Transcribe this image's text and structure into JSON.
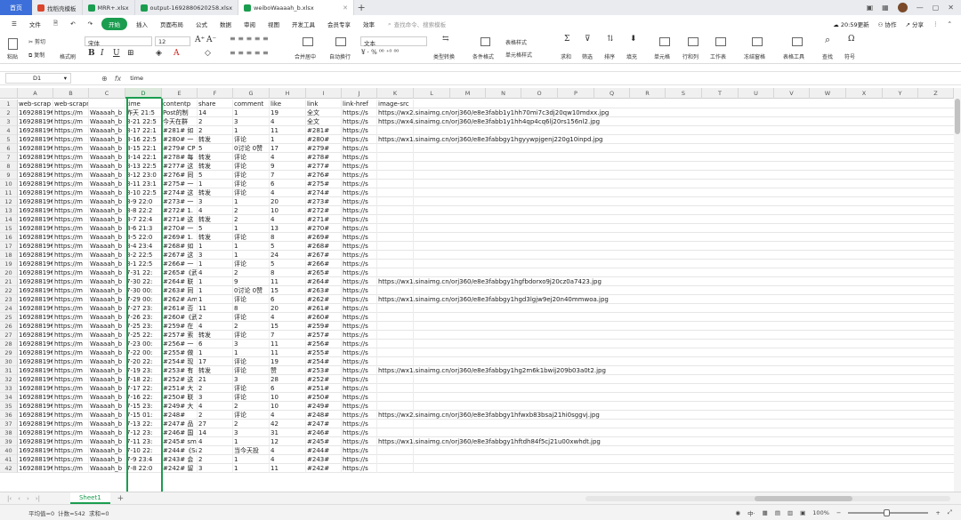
{
  "tabs": {
    "home": "首页",
    "t1": "找稻壳模板",
    "t2": "MRR+.xlsx",
    "t3": "output-1692880620258.xlsx",
    "t4": "weiboWaaaah_b.xlsx"
  },
  "menu": {
    "file": "文件",
    "start": "开始",
    "insert": "插入",
    "layout": "页面布局",
    "formula": "公式",
    "data": "数据",
    "review": "审阅",
    "view": "视图",
    "dev": "开发工具",
    "member": "会员专享",
    "efficiency": "效率",
    "search": "查找命令、搜索模板",
    "update": "20:59更新",
    "collab": "协作",
    "share": "分享"
  },
  "ribbon": {
    "paste": "粘贴",
    "cut": "剪切",
    "copy": "复制",
    "painter": "格式刷",
    "font": "宋体",
    "size": "12",
    "merge": "合并居中",
    "wrap": "自动换行",
    "numfmt": "文本",
    "typeconv": "类型转换",
    "condfmt": "条件格式",
    "tablestyle": "表格样式",
    "cellstyle": "单元格样式",
    "sum": "求和",
    "filter": "筛选",
    "sort": "排序",
    "fill": "填充",
    "cell": "单元格",
    "rowcol": "行和列",
    "sheet": "工作表",
    "freeze": "冻结窗格",
    "tabletool": "表格工具",
    "find": "查找",
    "symbol": "符号"
  },
  "formula_bar": {
    "cell_ref": "D1",
    "value": "time"
  },
  "columns": [
    "A",
    "B",
    "C",
    "D",
    "E",
    "F",
    "G",
    "H",
    "I",
    "J",
    "K",
    "L",
    "M",
    "N",
    "O",
    "P",
    "Q",
    "R",
    "S",
    "T",
    "U",
    "V",
    "W",
    "X",
    "Y",
    "Z"
  ],
  "header_row": [
    "web-scrap",
    "web-scrapname",
    "",
    "time",
    "contentp",
    "share",
    "comment",
    "like",
    "link",
    "link-href",
    "image-src"
  ],
  "rows": [
    [
      "16928819€",
      "https://m",
      "Waaaah_b",
      "昨天 21:5",
      "Post的制",
      "14",
      "1",
      "19",
      "全文",
      "https://s",
      "https://wx2.sinaimg.cn/orj360/e8e3fabb1y1hh70mi7c3dj20qw10mdxx.jpg"
    ],
    [
      "16928819€",
      "https://m",
      "Waaaah_b",
      "8-21 22:5",
      "今天在群",
      "2",
      "3",
      "4",
      "全文",
      "https://s",
      "https://wx4.sinaimg.cn/orj360/e8e3fabb1y1hh4qp4cq6lj20rs156nl2.jpg"
    ],
    [
      "16928819€",
      "https://m",
      "Waaaah_b",
      "8-17 22:1",
      "#281# 如",
      "2",
      "1",
      "11",
      "#281#",
      "https://s",
      ""
    ],
    [
      "16928819€",
      "https://m",
      "Waaaah_b",
      "8-16 22:5",
      "#280# 一",
      "转发",
      "评论",
      "1",
      "#280#",
      "https://s",
      "https://wx1.sinaimg.cn/orj360/e8e3fabbgy1hgyywpjgenj220g10inpd.jpg"
    ],
    [
      "16928819€",
      "https://m",
      "Waaaah_b",
      "8-15 22:1",
      "#279# CP",
      "5",
      "0讨论 0赞",
      "17",
      "#279#",
      "https://s",
      ""
    ],
    [
      "16928819€",
      "https://m",
      "Waaaah_b",
      "8-14 22:1",
      "#278# 每",
      "转发",
      "评论",
      "4",
      "#278#",
      "https://s",
      ""
    ],
    [
      "16928819€",
      "https://m",
      "Waaaah_b",
      "8-13 22:5",
      "#277# 这",
      "转发",
      "评论",
      "9",
      "#277#",
      "https://s",
      ""
    ],
    [
      "16928819€",
      "https://m",
      "Waaaah_b",
      "8-12 23:0",
      "#276# 同",
      "5",
      "评论",
      "7",
      "#276#",
      "https://s",
      ""
    ],
    [
      "16928819€",
      "https://m",
      "Waaaah_b",
      "8-11 23:1",
      "#275# 一",
      "1",
      "评论",
      "6",
      "#275#",
      "https://s",
      ""
    ],
    [
      "16928819€",
      "https://m",
      "Waaaah_b",
      "8-10 22:5",
      "#274# 这",
      "转发",
      "评论",
      "4",
      "#274#",
      "https://s",
      ""
    ],
    [
      "16928819€",
      "https://m",
      "Waaaah_b",
      "8-9 22:0",
      "#273# 一",
      "3",
      "1",
      "20",
      "#273#",
      "https://s",
      ""
    ],
    [
      "16928819€",
      "https://m",
      "Waaaah_b",
      "8-8 22:2",
      "#272# 1.",
      "4",
      "2",
      "10",
      "#272#",
      "https://s",
      ""
    ],
    [
      "16928819€",
      "https://m",
      "Waaaah_b",
      "8-7 22:4",
      "#271# 这",
      "转发",
      "2",
      "4",
      "#271#",
      "https://s",
      ""
    ],
    [
      "16928819€",
      "https://m",
      "Waaaah_b",
      "8-6 21:3",
      "#270# 一",
      "5",
      "1",
      "13",
      "#270#",
      "https://s",
      ""
    ],
    [
      "16928819€",
      "https://m",
      "Waaaah_b",
      "8-5 22:0",
      "#269# 1.",
      "转发",
      "评论",
      "8",
      "#269#",
      "https://s",
      ""
    ],
    [
      "16928819€",
      "https://m",
      "Waaaah_b",
      "8-4 23:4",
      "#268# 如",
      "1",
      "1",
      "5",
      "#268#",
      "https://s",
      ""
    ],
    [
      "16928819€",
      "https://m",
      "Waaaah_b",
      "8-2 22:5",
      "#267# 这",
      "3",
      "1",
      "24",
      "#267#",
      "https://s",
      ""
    ],
    [
      "16928819€",
      "https://m",
      "Waaaah_b",
      "8-1 22:5",
      "#266# 一",
      "1",
      "评论",
      "5",
      "#266#",
      "https://s",
      ""
    ],
    [
      "16928819€",
      "https://m",
      "Waaaah_b",
      "7-31 22:",
      "#265#《武",
      "4",
      "2",
      "8",
      "#265#",
      "https://s",
      ""
    ],
    [
      "16928819€",
      "https://m",
      "Waaaah_b",
      "7-30 22:",
      "#264# 联",
      "1",
      "9",
      "11",
      "#264#",
      "https://s",
      "https://wx1.sinaimg.cn/orj360/e8e3fabbgy1hgfbdorxo9j20cz0a7423.jpg"
    ],
    [
      "16928819€",
      "https://m",
      "Waaaah_b",
      "7-30 00:",
      "#263# 同",
      "1",
      "0讨论 0赞",
      "15",
      "#263#",
      "https://s",
      ""
    ],
    [
      "16928819€",
      "https://m",
      "Waaaah_b",
      "7-29 00:",
      "#262# Am",
      "1",
      "评论",
      "6",
      "#262#",
      "https://s",
      "https://wx1.sinaimg.cn/orj360/e8e3fabbgy1hgd3lgjw9ej20n40mmwoa.jpg"
    ],
    [
      "16928819€",
      "https://m",
      "Waaaah_b",
      "7-27 23:",
      "#261# 否",
      "11",
      "8",
      "20",
      "#261#",
      "https://s",
      ""
    ],
    [
      "16928819€",
      "https://m",
      "Waaaah_b",
      "7-26 23:",
      "#260#《武",
      "2",
      "评论",
      "4",
      "#260#",
      "https://s",
      ""
    ],
    [
      "16928819€",
      "https://m",
      "Waaaah_b",
      "7-25 23:",
      "#259# 在",
      "4",
      "2",
      "15",
      "#259#",
      "https://s",
      ""
    ],
    [
      "16928819€",
      "https://m",
      "Waaaah_b",
      "7-25 22:",
      "#257# 索",
      "转发",
      "评论",
      "7",
      "#257#",
      "https://s",
      ""
    ],
    [
      "16928819€",
      "https://m",
      "Waaaah_b",
      "7-23 00:",
      "#256# 一",
      "6",
      "3",
      "11",
      "#256#",
      "https://s",
      ""
    ],
    [
      "16928819€",
      "https://m",
      "Waaaah_b",
      "7-22 00:",
      "#255# 做",
      "1",
      "1",
      "11",
      "#255#",
      "https://s",
      ""
    ],
    [
      "16928819€",
      "https://m",
      "Waaaah_b",
      "7-20 22:",
      "#254# 现",
      "17",
      "评论",
      "19",
      "#254#",
      "https://s",
      ""
    ],
    [
      "16928819€",
      "https://m",
      "Waaaah_b",
      "7-19 23:",
      "#253# 有",
      "转发",
      "评论",
      "赞",
      "#253#",
      "https://s",
      "https://wx1.sinaimg.cn/orj360/e8e3fabbgy1hg2m6k1bwij209b03a0t2.jpg"
    ],
    [
      "16928819€",
      "https://m",
      "Waaaah_b",
      "7-18 22:",
      "#252# 这",
      "21",
      "3",
      "28",
      "#252#",
      "https://s",
      ""
    ],
    [
      "16928819€",
      "https://m",
      "Waaaah_b",
      "7-17 22:",
      "#251# 大",
      "2",
      "评论",
      "6",
      "#251#",
      "https://s",
      ""
    ],
    [
      "16928819€",
      "https://m",
      "Waaaah_b",
      "7-16 22:",
      "#250# 联",
      "3",
      "评论",
      "10",
      "#250#",
      "https://s",
      ""
    ],
    [
      "16928819€",
      "https://m",
      "Waaaah_b",
      "7-15 23:",
      "#249# 大",
      "4",
      "2",
      "10",
      "#249#",
      "https://s",
      ""
    ],
    [
      "16928819€",
      "https://m",
      "Waaaah_b",
      "7-15 01:",
      "#248#",
      "2",
      "评论",
      "4",
      "#248#",
      "https://s",
      "https://wx2.sinaimg.cn/orj360/e8e3fabbgy1hfwxb83bsaj21hi0sggvj.jpg"
    ],
    [
      "16928819€",
      "https://m",
      "Waaaah_b",
      "7-13 22:",
      "#247# 品",
      "27",
      "2",
      "42",
      "#247#",
      "https://s",
      ""
    ],
    [
      "16928819€",
      "https://m",
      "Waaaah_b",
      "7-12 23:",
      "#246# 国",
      "14",
      "3",
      "31",
      "#246#",
      "https://s",
      ""
    ],
    [
      "16928819€",
      "https://m",
      "Waaaah_b",
      "7-11 23:",
      "#245# sm",
      "4",
      "1",
      "12",
      "#245#",
      "https://s",
      "https://wx1.sinaimg.cn/orj360/e8e3fabbgy1hftdh84f5cj21u00xwhdt.jpg"
    ],
    [
      "16928819€",
      "https://m",
      "Waaaah_b",
      "7-10 22:",
      "#244#《Sa",
      "2",
      "当今天投",
      "4",
      "#244#",
      "https://s",
      ""
    ],
    [
      "16928819€",
      "https://m",
      "Waaaah_b",
      "7-9 23:4",
      "#243# 会",
      "2",
      "1",
      "4",
      "#243#",
      "https://s",
      ""
    ],
    [
      "16928819€",
      "https://m",
      "Waaaah_b",
      "7-8 22:0",
      "#242# 留",
      "3",
      "1",
      "11",
      "#242#",
      "https://s",
      ""
    ]
  ],
  "sheet": {
    "name": "Sheet1"
  },
  "status": {
    "avg": "平均值=0",
    "count": "计数=542",
    "sum": "求和=0",
    "zoom": "100%"
  }
}
